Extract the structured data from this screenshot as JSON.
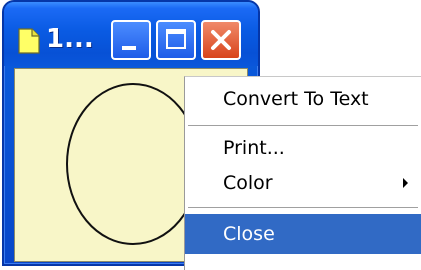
{
  "window": {
    "title": "1...",
    "icon": "sticky-note-icon",
    "buttons": {
      "minimize_icon": "minimize-icon",
      "maximize_icon": "maximize-icon",
      "close_icon": "close-icon"
    },
    "note_color": "#f8f6c8",
    "titlebar_color": "#0a5be3"
  },
  "note": {
    "drawing": "circle"
  },
  "context_menu": {
    "items": [
      {
        "label": "Convert To Text",
        "highlighted": false,
        "has_submenu": false
      },
      {
        "label": "Print...",
        "highlighted": false,
        "has_submenu": false
      },
      {
        "label": "Color",
        "highlighted": false,
        "has_submenu": true
      },
      {
        "label": "Close",
        "highlighted": true,
        "has_submenu": false
      }
    ],
    "highlight_color": "#316ac5"
  }
}
